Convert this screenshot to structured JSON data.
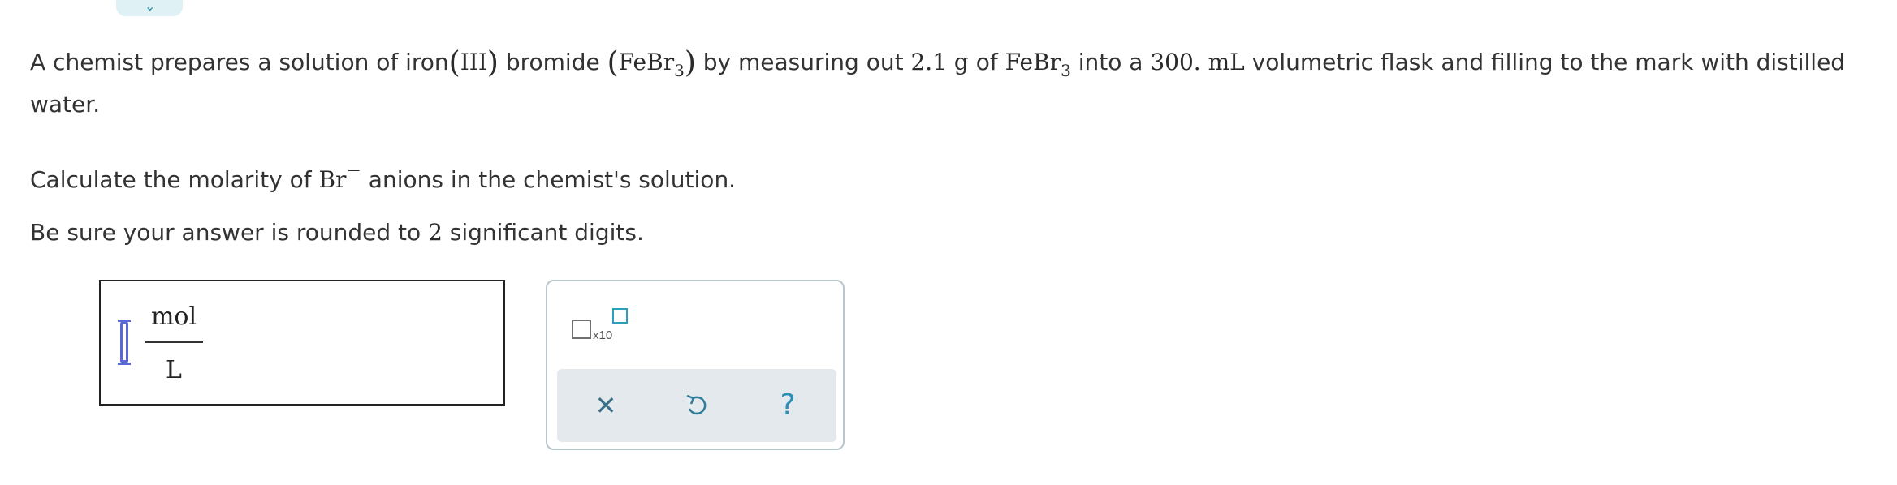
{
  "question": {
    "line1_intro": "A chemist prepares a solution of iron",
    "oxidation_state": "III",
    "line1_after_ox": " bromide ",
    "formula_base": "FeBr",
    "formula_sub": "3",
    "line1_measure": " by measuring out ",
    "mass_value": "2.1",
    "mass_unit": "g",
    "line1_of": " of ",
    "line1_into": " into a ",
    "volume_value": "300.",
    "volume_unit": "mL",
    "line1_end": " volumetric flask and filling to the mark with distilled",
    "line2": "water.",
    "calc_prefix": "Calculate the molarity of ",
    "ion_symbol": "Br",
    "ion_charge": "−",
    "calc_suffix": " anions in the chemist's solution.",
    "round_prefix": "Be sure your answer is rounded to ",
    "sig_figs": "2",
    "round_suffix": " significant digits."
  },
  "answer": {
    "value": "",
    "unit_numerator": "mol",
    "unit_denominator": "L"
  },
  "tools": {
    "sci_notation_label": "x10",
    "clear_icon": "close-icon",
    "undo_icon": "undo-icon",
    "help_icon": "help-icon",
    "clear_glyph": "✕",
    "help_glyph": "?"
  },
  "colors": {
    "accent": "#2b8fa6",
    "cursor": "#5a68d8",
    "panel_border": "#b8c7cc",
    "action_bar": "#e3e9ec"
  }
}
